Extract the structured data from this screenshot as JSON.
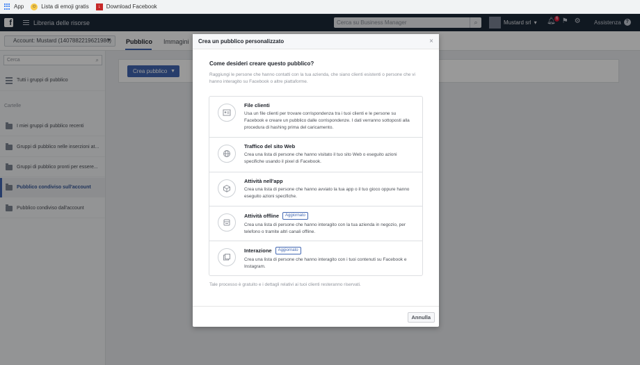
{
  "bookmarks": {
    "apps_label": "App",
    "emoji_label": "Lista di emoji gratis",
    "facebook_label": "Download Facebook"
  },
  "topnav": {
    "title": "Libreria delle risorse",
    "search_placeholder": "Cerca su Business Manager",
    "account_name": "Mustard srl",
    "notification_count": "6",
    "help_label": "Assistenza"
  },
  "subbar": {
    "account_select": "Account: Mustard (1407882219621986)",
    "tabs": [
      "Pubblico",
      "Immagini"
    ]
  },
  "sidebar": {
    "search_placeholder": "Cerca",
    "all_groups": "Tutti i gruppi di pubblico",
    "section_title": "Cartelle",
    "folders": [
      "I miei gruppi di pubblico recenti",
      "Gruppi di pubblico nelle inserzioni at...",
      "Gruppi di pubblico pronti per essere...",
      "Pubblico condiviso sull'account",
      "Pubblico condiviso dall'account"
    ]
  },
  "main": {
    "create_button": "Crea pubblico"
  },
  "modal": {
    "title": "Crea un pubblico personalizzato",
    "question": "Come desideri creare questo pubblico?",
    "description": "Raggiungi le persone che hanno contatti con la tua azienda, che siano clienti esistenti o persone che vi hanno interagito su Facebook o altre piattaforme.",
    "options": [
      {
        "title": "File clienti",
        "tag": "",
        "desc": "Usa un file clienti per trovare corrispondenza tra i tuoi clienti e le persone su Facebook e creare un pubblico dalle corrispondenze. I dati verranno sottoposti alla procedura di hashing prima del caricamento.",
        "icon": "customer-file-icon"
      },
      {
        "title": "Traffico del sito Web",
        "tag": "",
        "desc": "Crea una lista di persone che hanno visitato il tuo sito Web o eseguito azioni specifiche usando il pixel di Facebook.",
        "icon": "globe-icon"
      },
      {
        "title": "Attività nell'app",
        "tag": "",
        "desc": "Crea una lista di persone che hanno avviato la tua app o il tuo gioco oppure hanno eseguito azioni specifiche.",
        "icon": "cube-icon"
      },
      {
        "title": "Attività offline",
        "tag": "Aggiornato",
        "desc": "Crea una lista di persone che hanno interagito con la tua azienda in negozio, per telefono o tramite altri canali offline.",
        "icon": "store-icon"
      },
      {
        "title": "Interazione",
        "tag": "Aggiornato",
        "desc": "Crea una lista di persone che hanno interagito con i tuoi contenuti su Facebook e Instagram.",
        "icon": "engagement-icon"
      }
    ],
    "footnote": "Tale processo è gratuito e i dettagli relativi ai tuoi clienti resteranno riservati.",
    "cancel_button": "Annulla"
  },
  "colors": {
    "nav_bg": "#1c2838",
    "accent": "#4267b2"
  }
}
